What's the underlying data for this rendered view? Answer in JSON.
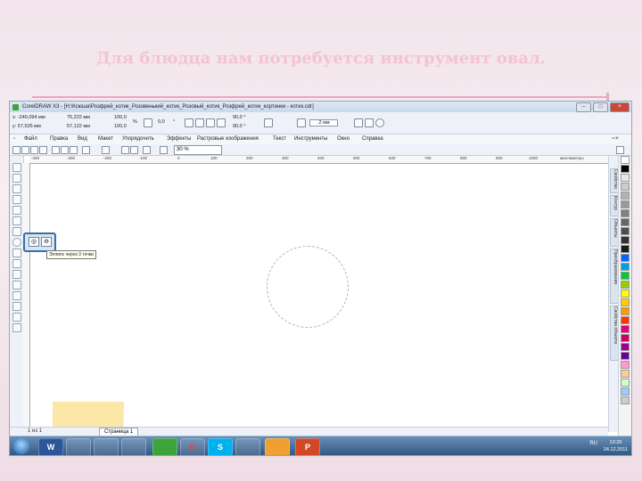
{
  "slide": {
    "title": "Для блюдца нам потребуется инструмент овал."
  },
  "window": {
    "title": "CorelDRAW X3 - [H:\\Ксюша\\Розфрей_котик_Розовенький_котик_Розовый_котик_Розфрей_котик_кортинки - котик.cdr]"
  },
  "propbar": {
    "x": "x: -240,094 мм",
    "y": "y: 57,535 мм",
    "w": "75,222 мм",
    "h": "57,122 мм",
    "scale_w": "100,0",
    "scale_h": "100,0",
    "percent": "%",
    "angle": "0,0",
    "angle_unit": "°",
    "start_angle": "90,0 °",
    "end_angle": "90,0 °",
    "outline": ".2 мм"
  },
  "menu": [
    "Файл",
    "Правка",
    "Вид",
    "Макет",
    "Упорядочить",
    "Эффекты",
    "Растровые изображения",
    "Текст",
    "Инструменты",
    "Окно",
    "Справка"
  ],
  "stdbar": {
    "zoom": "30 %"
  },
  "ruler": {
    "ticks": [
      "-400",
      "-300",
      "-200",
      "-100",
      "0",
      "100",
      "200",
      "300",
      "400",
      "500",
      "600",
      "700",
      "800",
      "900",
      "1000"
    ],
    "unit": "миллиметры"
  },
  "tooltip": "Эллипс через 3 точки",
  "docker_tabs": [
    "Свойства",
    "Контур",
    "Объекты",
    "Преобразования",
    "Свойства объекта"
  ],
  "palette": [
    "#ffffff",
    "#000000",
    "#e6e6e6",
    "#cccccc",
    "#b3b3b3",
    "#999999",
    "#808080",
    "#666666",
    "#4d4d4d",
    "#333333",
    "#1a1a1a",
    "#0066ff",
    "#00a0e6",
    "#00cc33",
    "#99cc00",
    "#ffff00",
    "#ffcc00",
    "#ff9900",
    "#ff3300",
    "#e6007e",
    "#cc0066",
    "#990099",
    "#660099",
    "#ff99cc",
    "#ffcc99",
    "#ccffcc",
    "#99ccff",
    "#cccccc"
  ],
  "statusbar": {
    "nav": "1 из 1",
    "page_tab": "Страница 1"
  },
  "taskbar": {
    "app_labels": [
      "W",
      "",
      "",
      "",
      "",
      "O",
      "S",
      "",
      "",
      "P"
    ],
    "lang": "RU",
    "time": "13:29",
    "date": "24.12.2011"
  }
}
